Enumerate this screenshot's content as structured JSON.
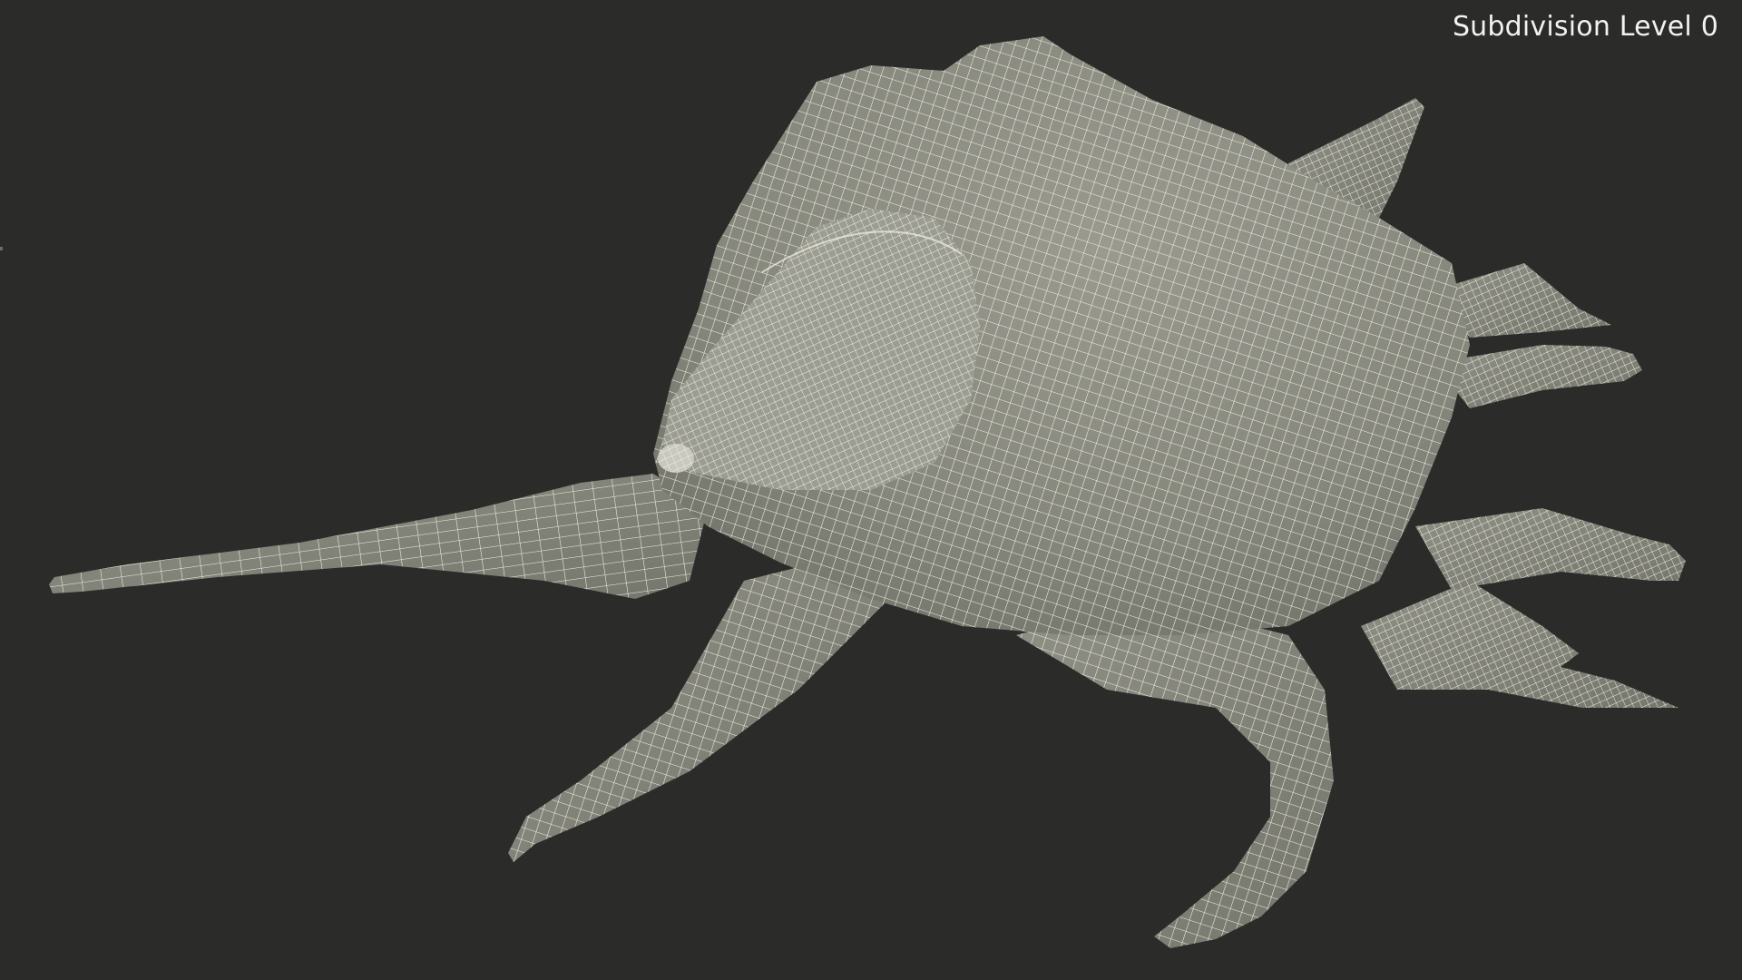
{
  "viewport": {
    "label": "Subdivision Level 0",
    "background": "#2b2b2a"
  },
  "model": {
    "subject": "spider conch shell",
    "display_mode": "wireframe on shaded",
    "surface_color": "#8d8d82",
    "wire_color": "#f4f1e6"
  }
}
